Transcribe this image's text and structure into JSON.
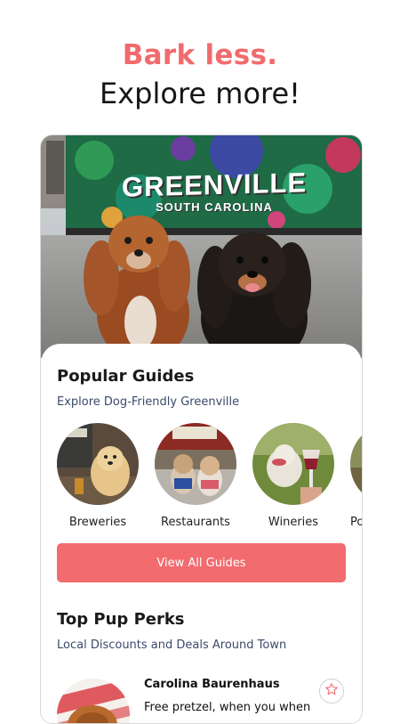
{
  "header": {
    "line1": "Bark less.",
    "line2": "Explore more!"
  },
  "hero": {
    "mural_title": "GREENVILLE",
    "mural_subtitle": "SOUTH CAROLINA"
  },
  "popular": {
    "title": "Popular Guides",
    "subtitle": "Explore Dog-Friendly Greenville",
    "items": [
      {
        "label": "Breweries"
      },
      {
        "label": "Restaurants"
      },
      {
        "label": "Wineries"
      },
      {
        "label": "Po"
      }
    ],
    "button_label": "View All Guides"
  },
  "perks": {
    "title": "Top Pup Perks",
    "subtitle": "Local Discounts and Deals Around Town",
    "item": {
      "name": "Carolina Baurenhaus",
      "description": "Free pretzel, when you when"
    }
  },
  "colors": {
    "accent": "#f26b6f",
    "heading": "#1a1a1a",
    "subtext": "#3b4a6b"
  },
  "icons": {
    "favorite": "star-outline-icon"
  }
}
